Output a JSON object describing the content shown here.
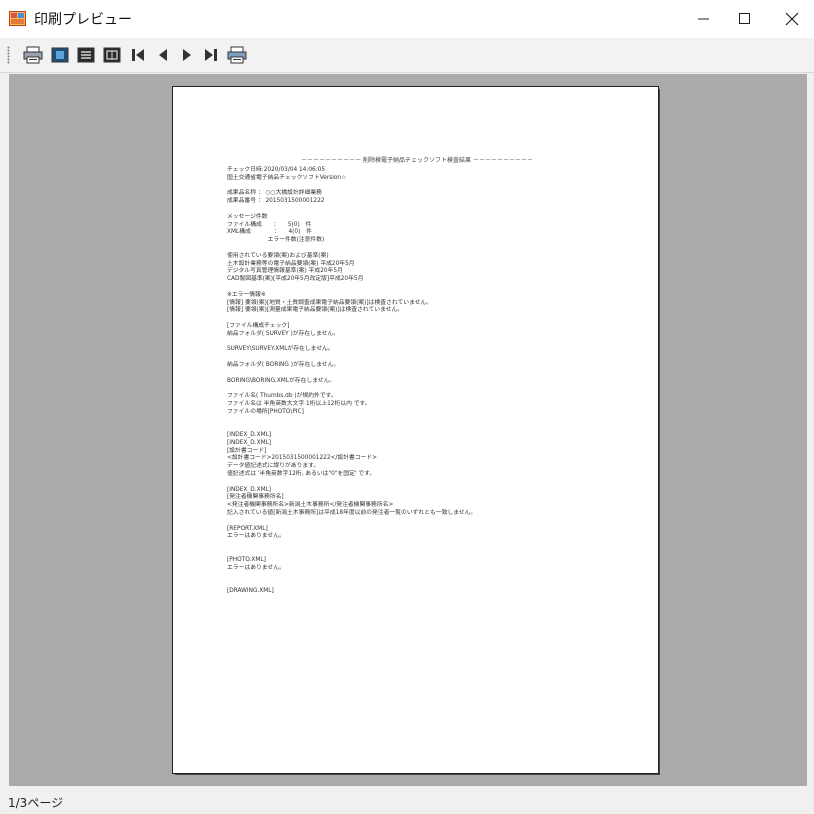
{
  "window": {
    "title": "印刷プレビュー",
    "min_glyph": "—",
    "max_glyph": "☐",
    "close_glyph": "✕"
  },
  "toolbar": {
    "buttons": [
      {
        "name": "print-button",
        "icon": "printer-icon"
      },
      {
        "name": "one-page-button",
        "icon": "one-page-icon"
      },
      {
        "name": "two-pages-button",
        "icon": "two-pages-icon"
      },
      {
        "name": "four-pages-button",
        "icon": "four-pages-icon"
      },
      {
        "name": "first-page-button",
        "icon": "first-page-icon"
      },
      {
        "name": "prev-page-button",
        "icon": "prev-page-icon"
      },
      {
        "name": "next-page-button",
        "icon": "next-page-icon"
      },
      {
        "name": "last-page-button",
        "icon": "last-page-icon"
      },
      {
        "name": "page-setup-button",
        "icon": "page-setup-icon"
      }
    ]
  },
  "status": {
    "page_indicator": "1/3ページ"
  },
  "document": {
    "header": "－－－－－－－－－－ 削除検電子納品チェックソフト検査結果 －－－－－－－－－－",
    "lines": [
      "チェック日時:2020/03/04 14:06:05",
      "国土交通省電子納品チェックソフトVersion☆",
      "",
      "成果品名称 ： ○○大橋設計詳細業務",
      "成果品番号 ： 2015031500001222",
      "",
      "メッセージ件数",
      "ファイル構成　　：　　5(0)　件",
      "XML構成　　　　：　　4(0)　件",
      "　　　　　　　エラー件数(注意件数)",
      "",
      "使用されている要領(案)および基準(案)",
      "土木設計業務等の電子納品要領(案) 平成20年5月",
      "デジタル写真管理情報基準(案) 平成20年5月",
      "CAD製図基準(案)[平成20年5月改定版]平成20年5月",
      "",
      "※エラー情報※",
      "[情報] 要領(案)[地質・土質調査成果電子納品要領(案)]は検査されていません。",
      "[情報] 要領(案)[測量成果電子納品要領(案)]は検査されていません。",
      "",
      "[ファイル構成チェック]",
      "納品フォルダ( SURVEY )が存在しません。",
      "",
      "SURVEY\\SURVEY.XMLが存在しません。",
      "",
      "納品フォルダ( BORING )が存在しません。",
      "",
      "BORING\\BORING.XMLが存在しません。",
      "",
      "ファイル名( Thumbs.db )が規約外です。",
      "ファイル名は 半角英数大文字 1桁以上12桁以内 です。",
      "ファイルの場所[PHOTO\\PIC]",
      "",
      "",
      "[INDEX_D.XML]",
      "[INDEX_D.XML]",
      "[設計書コード]",
      "<設計書コード>2015031500001222</設計書コード>",
      "データ値記述式に誤りがあります。",
      "値記述式は '半角英数字12桁, あるいは\"0\"を固定' です。",
      "",
      "[INDEX_D.XML]",
      "[発注者機関事務所名]",
      "<発注者機関事務所名>新潟土木事務所</発注者機関事務所名>",
      "記入されている値[新潟土木事務所]は平成18年度以前の発注者一覧のいずれとも一致しません。",
      "",
      "[REPORT.XML]",
      "エラーはありません。",
      "",
      "",
      "[PHOTO.XML]",
      "エラーはありません。",
      "",
      "",
      "[DRAWING.XML]"
    ]
  }
}
